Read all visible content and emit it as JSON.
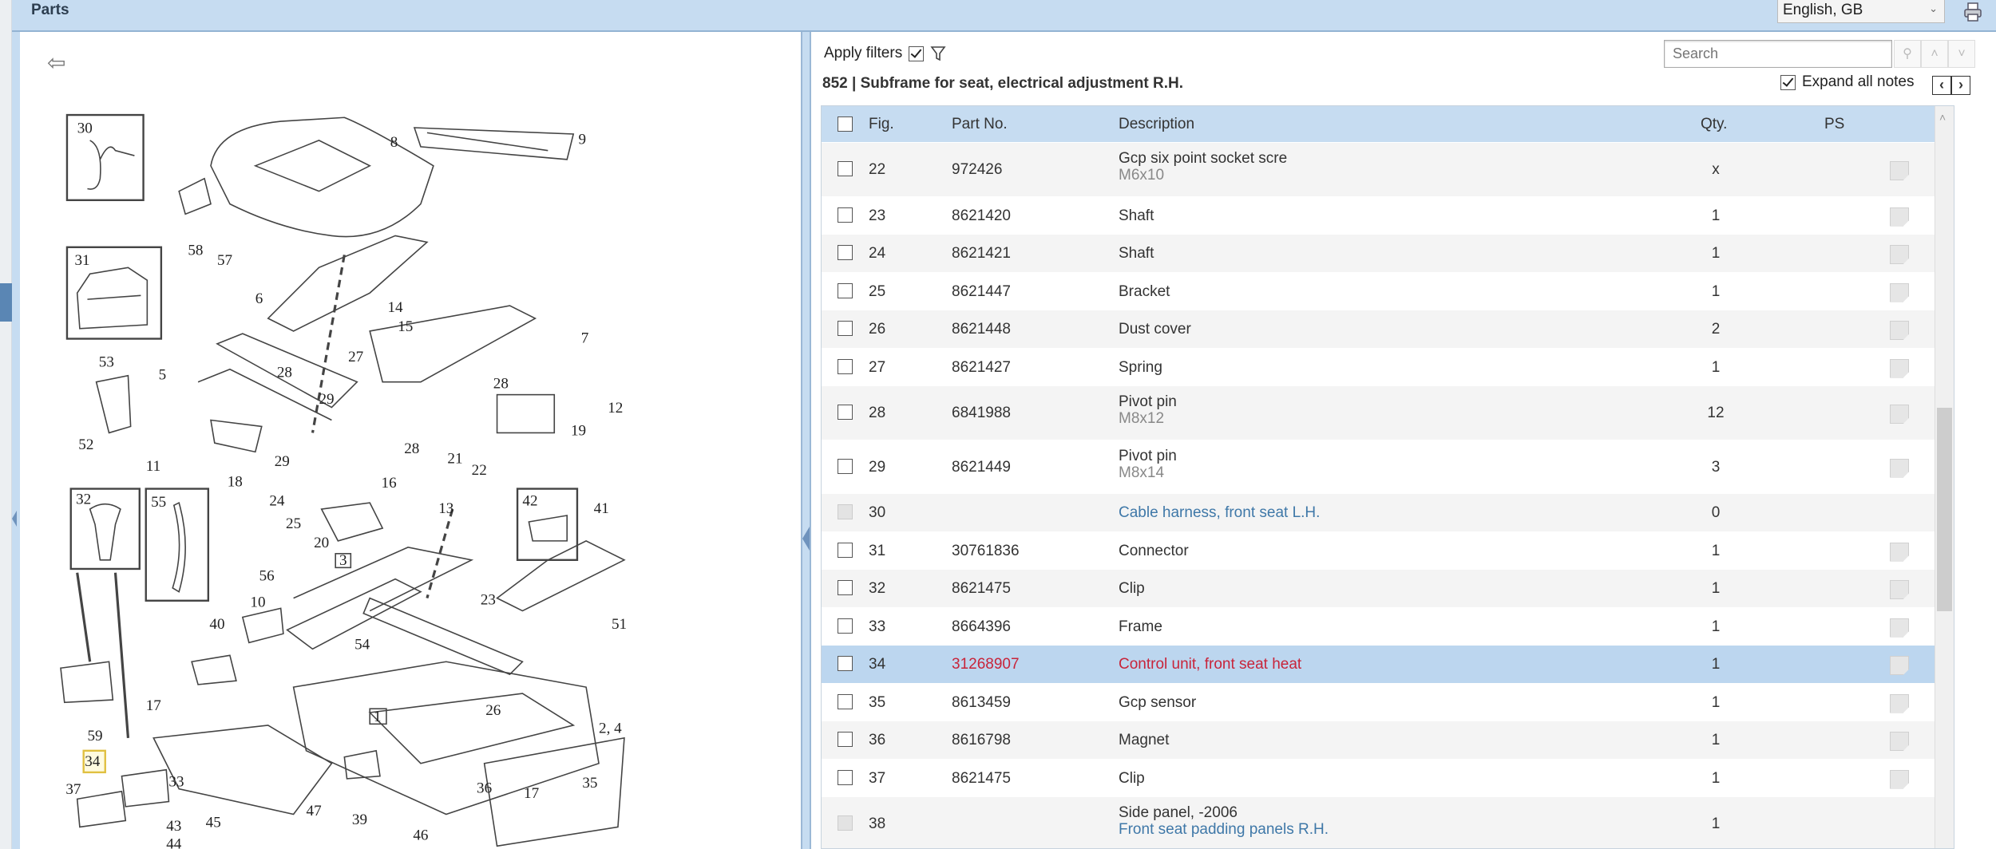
{
  "header": {
    "title": "Parts",
    "language": "English, GB"
  },
  "filters": {
    "label": "Apply filters",
    "checked": true
  },
  "section": {
    "title": "852  |  Subframe for seat, electrical adjustment   R.H."
  },
  "search": {
    "placeholder": "Search"
  },
  "expand_notes": {
    "label": "Expand all notes",
    "checked": true
  },
  "table": {
    "columns": {
      "fig": "Fig.",
      "part": "Part No.",
      "desc": "Description",
      "qty": "Qty.",
      "ps": "PS"
    },
    "rows": [
      {
        "fig": "22",
        "part": "972426",
        "desc": "Gcp six point socket scre",
        "sub": "M6x10",
        "qty": "x",
        "state": "normal"
      },
      {
        "fig": "23",
        "part": "8621420",
        "desc": "Shaft",
        "qty": "1",
        "state": "normal"
      },
      {
        "fig": "24",
        "part": "8621421",
        "desc": "Shaft",
        "qty": "1",
        "state": "normal"
      },
      {
        "fig": "25",
        "part": "8621447",
        "desc": "Bracket",
        "qty": "1",
        "state": "normal"
      },
      {
        "fig": "26",
        "part": "8621448",
        "desc": "Dust cover",
        "qty": "2",
        "state": "normal"
      },
      {
        "fig": "27",
        "part": "8621427",
        "desc": "Spring",
        "qty": "1",
        "state": "normal"
      },
      {
        "fig": "28",
        "part": "6841988",
        "desc": "Pivot pin",
        "sub": "M8x12",
        "qty": "12",
        "state": "normal"
      },
      {
        "fig": "29",
        "part": "8621449",
        "desc": "Pivot pin",
        "sub": "M8x14",
        "qty": "3",
        "state": "normal"
      },
      {
        "fig": "30",
        "part": "",
        "desc": "Cable harness, front seat   L.H.",
        "qty": "0",
        "state": "disabled",
        "link": true
      },
      {
        "fig": "31",
        "part": "30761836",
        "desc": "Connector",
        "qty": "1",
        "state": "normal"
      },
      {
        "fig": "32",
        "part": "8621475",
        "desc": "Clip",
        "qty": "1",
        "state": "normal"
      },
      {
        "fig": "33",
        "part": "8664396",
        "desc": "Frame",
        "qty": "1",
        "state": "normal"
      },
      {
        "fig": "34",
        "part": "31268907",
        "desc": "Control unit, front seat heat",
        "qty": "1",
        "state": "highlighted"
      },
      {
        "fig": "35",
        "part": "8613459",
        "desc": "Gcp sensor",
        "qty": "1",
        "state": "normal"
      },
      {
        "fig": "36",
        "part": "8616798",
        "desc": "Magnet",
        "qty": "1",
        "state": "normal"
      },
      {
        "fig": "37",
        "part": "8621475",
        "desc": "Clip",
        "qty": "1",
        "state": "normal"
      },
      {
        "fig": "38",
        "part": "",
        "desc": "Side panel, -2006",
        "sublink": "Front seat padding panels   R.H.",
        "qty": "1",
        "state": "disabled"
      }
    ]
  },
  "diagram": {
    "callouts": [
      "30",
      "31",
      "8",
      "9",
      "58",
      "57",
      "6",
      "14",
      "15",
      "7",
      "27",
      "53",
      "5",
      "28",
      "28",
      "12",
      "29",
      "52",
      "19",
      "28",
      "21",
      "22",
      "11",
      "18",
      "29",
      "16",
      "24",
      "13",
      "25",
      "20",
      "42",
      "41",
      "32",
      "55",
      "3",
      "56",
      "10",
      "23",
      "40",
      "51",
      "54",
      "17",
      "59",
      "26",
      "1",
      "2, 4",
      "34",
      "33",
      "37",
      "43",
      "44",
      "45",
      "47",
      "39",
      "36",
      "17",
      "35",
      "46"
    ],
    "highlighted": "34"
  },
  "colors": {
    "accent": "#c6dcf1",
    "highlight_row": "#bcd6ef",
    "highlight_text": "#c8243a",
    "link": "#3f78a8"
  }
}
